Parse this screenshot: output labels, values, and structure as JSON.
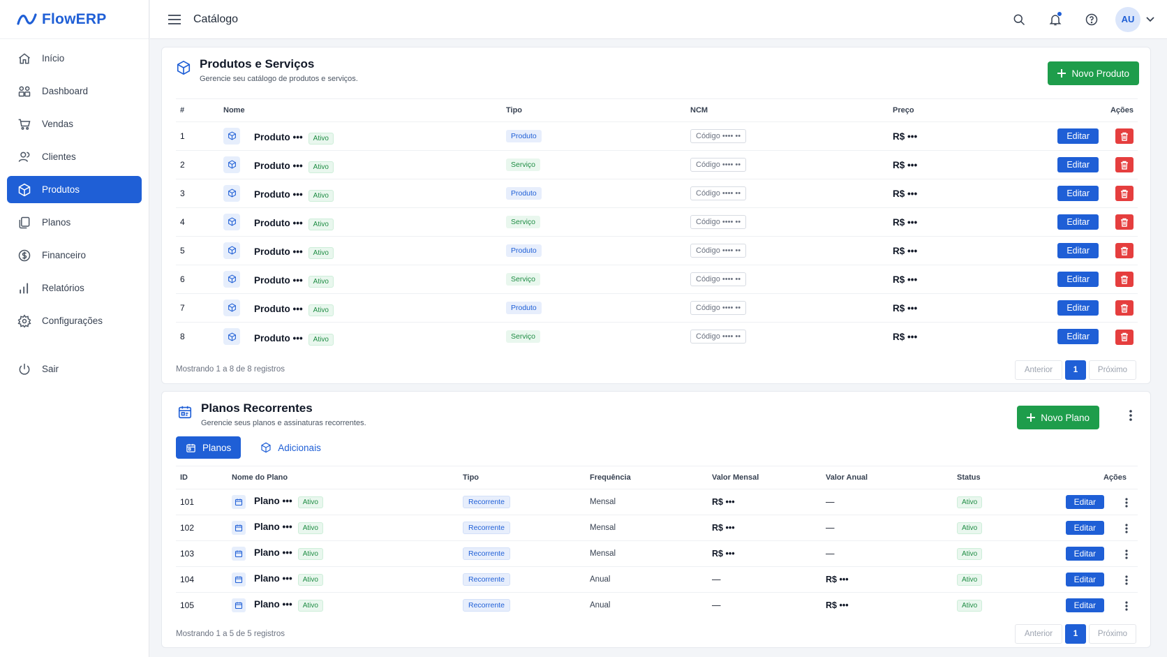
{
  "brand": {
    "name": "FlowERP"
  },
  "topbar": {
    "title": "Catálogo",
    "avatar": "AU"
  },
  "sidebar": {
    "items": [
      {
        "label": "Início",
        "icon": "home-icon"
      },
      {
        "label": "Dashboard",
        "icon": "dashboard-icon"
      },
      {
        "label": "Vendas",
        "icon": "cart-icon"
      },
      {
        "label": "Clientes",
        "icon": "users-icon"
      },
      {
        "label": "Produtos",
        "icon": "box-icon",
        "active": true
      },
      {
        "label": "Planos",
        "icon": "layers-icon"
      },
      {
        "label": "Financeiro",
        "icon": "dollar-icon"
      },
      {
        "label": "Relatórios",
        "icon": "bar-chart-icon"
      },
      {
        "label": "Configurações",
        "icon": "gear-icon"
      }
    ],
    "logout": "Sair"
  },
  "products": {
    "title": "Produtos e Serviços",
    "subtitle": "Gerencie seu catálogo de produtos e serviços.",
    "new_button": "Novo Produto",
    "columns": {
      "num": "#",
      "name": "Nome",
      "type": "Tipo",
      "ncm": "NCM",
      "price": "Preço",
      "actions": "Ações"
    },
    "rows": [
      {
        "num": "1",
        "name": "Produto •••",
        "status": "Ativo",
        "type": "Produto",
        "ncm": "Código •••• ••",
        "price": "R$ •••",
        "edit": "Editar"
      },
      {
        "num": "2",
        "name": "Produto •••",
        "status": "Ativo",
        "type": "Serviço",
        "ncm": "Código •••• ••",
        "price": "R$ •••",
        "edit": "Editar"
      },
      {
        "num": "3",
        "name": "Produto •••",
        "status": "Ativo",
        "type": "Produto",
        "ncm": "Código •••• ••",
        "price": "R$ •••",
        "edit": "Editar"
      },
      {
        "num": "4",
        "name": "Produto •••",
        "status": "Ativo",
        "type": "Serviço",
        "ncm": "Código •••• ••",
        "price": "R$ •••",
        "edit": "Editar"
      },
      {
        "num": "5",
        "name": "Produto •••",
        "status": "Ativo",
        "type": "Produto",
        "ncm": "Código •••• ••",
        "price": "R$ •••",
        "edit": "Editar"
      },
      {
        "num": "6",
        "name": "Produto •••",
        "status": "Ativo",
        "type": "Serviço",
        "ncm": "Código •••• ••",
        "price": "R$ •••",
        "edit": "Editar"
      },
      {
        "num": "7",
        "name": "Produto •••",
        "status": "Ativo",
        "type": "Produto",
        "ncm": "Código •••• ••",
        "price": "R$ •••",
        "edit": "Editar"
      },
      {
        "num": "8",
        "name": "Produto •••",
        "status": "Ativo",
        "type": "Serviço",
        "ncm": "Código •••• ••",
        "price": "R$ •••",
        "edit": "Editar"
      }
    ],
    "footer": "Mostrando 1 a 8 de 8 registros",
    "pager": {
      "prev": "Anterior",
      "current": "1",
      "next": "Próximo"
    }
  },
  "plans": {
    "title": "Planos Recorrentes",
    "subtitle": "Gerencie seus planos e assinaturas recorrentes.",
    "new_button": "Novo Plano",
    "tabs": [
      {
        "label": "Planos",
        "active": true
      },
      {
        "label": "Adicionais",
        "active": false
      }
    ],
    "columns": {
      "id": "ID",
      "name": "Nome do Plano",
      "type": "Tipo",
      "freq": "Frequência",
      "monthly": "Valor Mensal",
      "yearly": "Valor Anual",
      "status": "Status",
      "actions": "Ações"
    },
    "rows": [
      {
        "id": "101",
        "name": "Plano •••",
        "badge": "Ativo",
        "type": "Recorrente",
        "freq": "Mensal",
        "monthly": "R$ •••",
        "yearly": "—",
        "status": "Ativo",
        "edit": "Editar"
      },
      {
        "id": "102",
        "name": "Plano •••",
        "badge": "Ativo",
        "type": "Recorrente",
        "freq": "Mensal",
        "monthly": "R$ •••",
        "yearly": "—",
        "status": "Ativo",
        "edit": "Editar"
      },
      {
        "id": "103",
        "name": "Plano •••",
        "badge": "Ativo",
        "type": "Recorrente",
        "freq": "Mensal",
        "monthly": "R$ •••",
        "yearly": "—",
        "status": "Ativo",
        "edit": "Editar"
      },
      {
        "id": "104",
        "name": "Plano •••",
        "badge": "Ativo",
        "type": "Recorrente",
        "freq": "Anual",
        "monthly": "—",
        "yearly": "R$ •••",
        "status": "Ativo",
        "edit": "Editar"
      },
      {
        "id": "105",
        "name": "Plano •••",
        "badge": "Ativo",
        "type": "Recorrente",
        "freq": "Anual",
        "monthly": "—",
        "yearly": "R$ •••",
        "status": "Ativo",
        "edit": "Editar"
      }
    ],
    "footer": "Mostrando 1 a 5 de 5 registros",
    "pager": {
      "prev": "Anterior",
      "current": "1",
      "next": "Próximo"
    }
  },
  "colors": {
    "primary": "#1f5fd6",
    "success": "#1e9d4b",
    "danger": "#e53e3e"
  }
}
